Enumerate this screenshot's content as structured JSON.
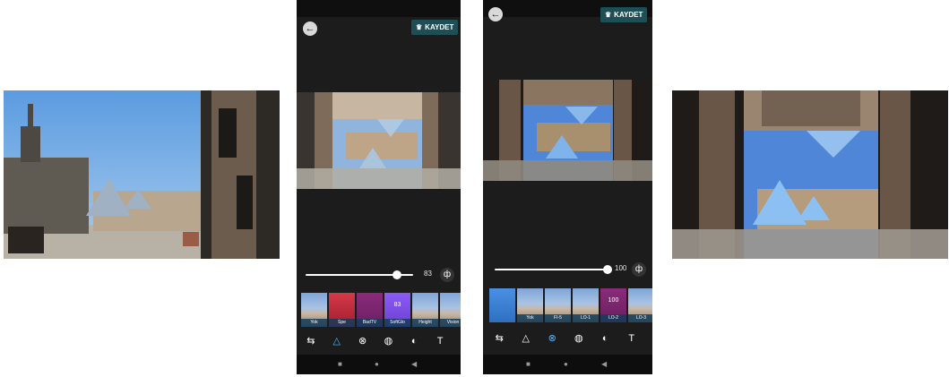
{
  "screens": [
    {
      "save_label": "KAYDET",
      "slider_value": "83",
      "filters": [
        {
          "label": "Yok",
          "mid": "",
          "style": ""
        },
        {
          "label": "Spe",
          "mid": "",
          "style": "t-red"
        },
        {
          "label": "BadTV",
          "mid": "",
          "style": "t-magenta"
        },
        {
          "label": "SoftGlo",
          "mid": "83",
          "style": "t-purple"
        },
        {
          "label": "Height",
          "mid": "",
          "style": ""
        },
        {
          "label": "Vision",
          "mid": "",
          "style": ""
        },
        {
          "label": "C",
          "mid": "",
          "style": "t-purple"
        }
      ]
    },
    {
      "save_label": "KAYDET",
      "slider_value": "100",
      "filters": [
        {
          "label": "",
          "mid": "",
          "style": "t-blue"
        },
        {
          "label": "Yok",
          "mid": "",
          "style": ""
        },
        {
          "label": "FI-5",
          "mid": "",
          "style": ""
        },
        {
          "label": "LO-1",
          "mid": "",
          "style": ""
        },
        {
          "label": "LO-2",
          "mid": "100",
          "style": "t-magenta"
        },
        {
          "label": "LO-3",
          "mid": "",
          "style": ""
        },
        {
          "label": "",
          "mid": "",
          "style": ""
        }
      ]
    }
  ],
  "icons": {
    "back": "←",
    "crown": "♛",
    "compare": "ф",
    "tools": [
      "⇆",
      "△",
      "⊗",
      "◍",
      "◐",
      "T"
    ],
    "nav": [
      "■",
      "●",
      "◀"
    ]
  },
  "colors": {
    "accent": "#4fb6ff",
    "save_bg": "#1e4f56",
    "app_bg": "#1c1c1c"
  }
}
